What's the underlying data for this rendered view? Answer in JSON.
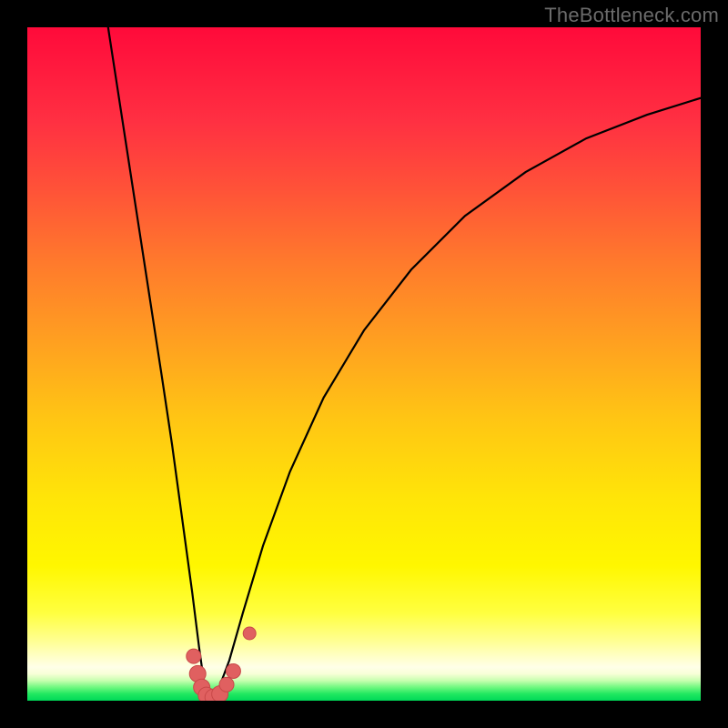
{
  "watermark": "TheBottleneck.com",
  "colors": {
    "frame_bg": "#000000",
    "curve_stroke": "#000000",
    "marker_fill": "#e06060",
    "marker_stroke": "#c84848",
    "gradient_stops": [
      "#ff0a3a",
      "#ff1a3e",
      "#ff3042",
      "#ff5238",
      "#ff7a2c",
      "#ffa120",
      "#ffc514",
      "#ffe508",
      "#fff700",
      "#ffff40",
      "#ffff90",
      "#ffffc8",
      "#ffffe8",
      "#f8ffd8",
      "#c8ffb0",
      "#70f880",
      "#20e860",
      "#00d858"
    ]
  },
  "chart_data": {
    "type": "line",
    "title": "",
    "xlabel": "",
    "ylabel": "",
    "xlim": [
      0,
      1
    ],
    "ylim": [
      0,
      1
    ],
    "x_minimum": 0.27,
    "left_curve": [
      {
        "x": 0.12,
        "y": 1.0
      },
      {
        "x": 0.14,
        "y": 0.87
      },
      {
        "x": 0.16,
        "y": 0.74
      },
      {
        "x": 0.18,
        "y": 0.61
      },
      {
        "x": 0.2,
        "y": 0.48
      },
      {
        "x": 0.215,
        "y": 0.38
      },
      {
        "x": 0.23,
        "y": 0.27
      },
      {
        "x": 0.245,
        "y": 0.16
      },
      {
        "x": 0.255,
        "y": 0.08
      },
      {
        "x": 0.262,
        "y": 0.03
      },
      {
        "x": 0.27,
        "y": 0.0
      }
    ],
    "right_curve": [
      {
        "x": 0.27,
        "y": 0.0
      },
      {
        "x": 0.285,
        "y": 0.02
      },
      {
        "x": 0.3,
        "y": 0.06
      },
      {
        "x": 0.32,
        "y": 0.13
      },
      {
        "x": 0.35,
        "y": 0.23
      },
      {
        "x": 0.39,
        "y": 0.34
      },
      {
        "x": 0.44,
        "y": 0.45
      },
      {
        "x": 0.5,
        "y": 0.55
      },
      {
        "x": 0.57,
        "y": 0.64
      },
      {
        "x": 0.65,
        "y": 0.72
      },
      {
        "x": 0.74,
        "y": 0.785
      },
      {
        "x": 0.83,
        "y": 0.835
      },
      {
        "x": 0.92,
        "y": 0.87
      },
      {
        "x": 1.0,
        "y": 0.895
      }
    ],
    "markers": [
      {
        "x": 0.247,
        "y": 0.066,
        "r": 8
      },
      {
        "x": 0.253,
        "y": 0.04,
        "r": 9
      },
      {
        "x": 0.259,
        "y": 0.02,
        "r": 9
      },
      {
        "x": 0.266,
        "y": 0.008,
        "r": 9
      },
      {
        "x": 0.276,
        "y": 0.005,
        "r": 9
      },
      {
        "x": 0.286,
        "y": 0.01,
        "r": 9
      },
      {
        "x": 0.296,
        "y": 0.024,
        "r": 8
      },
      {
        "x": 0.306,
        "y": 0.044,
        "r": 8
      },
      {
        "x": 0.33,
        "y": 0.1,
        "r": 7
      }
    ]
  }
}
